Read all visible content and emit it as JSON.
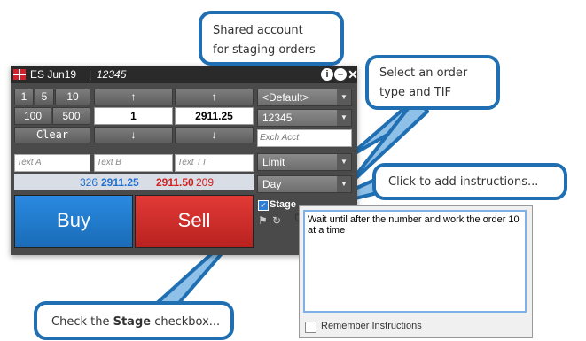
{
  "ticket": {
    "symbol": "ES Jun19",
    "separator": "|",
    "account": "12345",
    "qty_presets": [
      "1",
      "5",
      "10",
      "100",
      "500"
    ],
    "clear_label": "Clear",
    "quantity": "1",
    "price": "2911.25",
    "up_arrow": "↑",
    "down_arrow": "↓",
    "text_a_placeholder": "Text A",
    "text_b_placeholder": "Text B",
    "text_tt_placeholder": "Text TT",
    "bid_size": "326",
    "bid_price": "2911.25",
    "ask_price": "2911.50",
    "ask_size": "209",
    "buy_label": "Buy",
    "sell_label": "Sell",
    "default_dropdown": "<Default>",
    "account_dropdown": "12345",
    "exch_acct_placeholder": "Exch Acct",
    "order_type": "Limit",
    "tif": "Day",
    "stage_label": "Stage"
  },
  "popup": {
    "instructions": "Wait until after the number and work the order 10 at a time",
    "remember_label": "Remember Instructions"
  },
  "callouts": {
    "shared_account": [
      "Shared account",
      "for staging orders"
    ],
    "order_type": [
      "Select an order",
      "type and TIF"
    ],
    "instructions": "Click to add instructions...",
    "stage_prefix": "Check the ",
    "stage_bold": "Stage",
    "stage_suffix": " checkbox..."
  },
  "colors": {
    "buy": "#1d7ac8",
    "sell": "#d32a28",
    "bid_text": "#1f6fd0",
    "ask_text": "#d0201e",
    "callout_border": "#1f6fb2"
  }
}
